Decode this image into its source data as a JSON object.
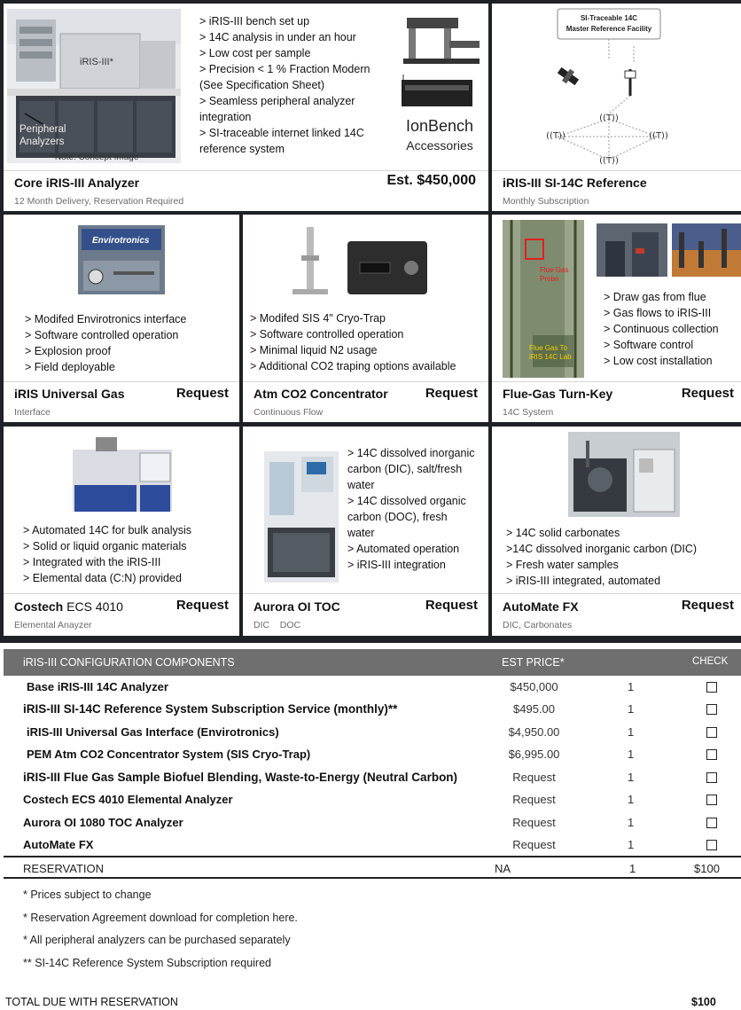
{
  "cards": {
    "core": {
      "bullets": [
        "> iRIS-III bench set up",
        "> 14C analysis in under an hour",
        "> Low cost per sample",
        "> Precision < 1 % Fraction Modern",
        "(See Specification Sheet)",
        "> Seamless peripheral analyzer",
        "integration",
        "> SI-traceable internet linked 14C",
        "reference system"
      ],
      "image_labels": {
        "device": "iRIS-III*",
        "peripheral": "Peripheral",
        "analyzers": "Analyzers",
        "note": "*Note: Concept Image"
      },
      "accessory_caption_1": "IonBench",
      "accessory_caption_2": "Accessories",
      "title": "Core iRIS-III Analyzer",
      "price": "Est. $450,000",
      "subtitle": "12 Month Delivery, Reservation Required"
    },
    "reference": {
      "diagram_title_1": "SI-Traceable 14C",
      "diagram_title_2": "Master Reference Facility",
      "title": "iRIS-III SI-14C Reference",
      "subtitle": "Monthly Subscription"
    },
    "gas": {
      "image_label": "Envirotronics",
      "bullets": [
        "> Modifed Envirotronics interface",
        "> Software controlled operation",
        "> Explosion proof",
        "> Field deployable"
      ],
      "title": "iRIS Universal Gas",
      "price": "Request",
      "subtitle": "Interface"
    },
    "co2": {
      "bullets": [
        "> Modifed SIS 4\" Cryo-Trap",
        "> Software controlled operation",
        "> Minimal liquid N2 usage",
        "> Additional CO2 traping options available"
      ],
      "title": "Atm CO2 Concentrator",
      "price": "Request",
      "subtitle": "Continuous Flow"
    },
    "flue": {
      "image_labels": {
        "probe": "Flue Gas Probe",
        "to_lab": "Flue Gas To iRIS 14C Lab"
      },
      "bullets": [
        "> Draw gas from flue",
        "> Gas flows to iRIS-III",
        "> Continuous collection",
        "> Software control",
        "> Low cost installation"
      ],
      "title": "Flue-Gas Turn-Key",
      "price": "Request",
      "subtitle": "14C System"
    },
    "costech": {
      "bullets": [
        "> Automated 14C for bulk analysis",
        "> Solid or liquid organic materials",
        "> Integrated with the iRIS-III",
        "> Elemental data (C:N) provided"
      ],
      "title_bold": "Costech",
      "title_rest": " ECS 4010",
      "price": "Request",
      "subtitle": "Elemental Anayzer"
    },
    "aurora": {
      "bullets": [
        "> 14C dissolved inorganic",
        "carbon (DIC), salt/fresh",
        "water",
        "> 14C dissolved organic",
        "carbon (DOC), fresh",
        "water",
        "> Automated operation",
        "> iRIS-III integration"
      ],
      "title": "Aurora OI TOC",
      "price": "Request",
      "subtitle": "DIC    DOC"
    },
    "automate": {
      "bullets": [
        "> 14C solid carbonates",
        ">14C dissolved inorganic carbon (DIC)",
        "> Fresh water samples",
        "> iRIS-III integrated, automated"
      ],
      "title": "AutoMate FX",
      "price": "Request",
      "subtitle": "DIC, Carbonates"
    }
  },
  "config": {
    "headers": {
      "component": "iRIS-III CONFIGURATION COMPONENTS",
      "price": "EST PRICE*",
      "check": "CHECK"
    },
    "rows": [
      {
        "name": "Base iRIS-III 14C Analyzer",
        "price": "$450,000",
        "qty": "1"
      },
      {
        "name": "iRIS-III SI-14C Reference System Subscription Service (monthly)**",
        "price": "$495.00",
        "qty": "1"
      },
      {
        "name": "iRIS-III Universal Gas Interface (Envirotronics)",
        "price": "$4,950.00",
        "qty": "1"
      },
      {
        "name": "PEM Atm CO2 Concentrator System (SIS Cryo-Trap)",
        "price": "$6,995.00",
        "qty": "1"
      },
      {
        "name": "iRIS-III Flue Gas Sample Biofuel Blending, Waste-to-Energy (Neutral Carbon)",
        "price": "Request",
        "qty": "1"
      },
      {
        "name": "Costech ECS 4010 Elemental Analyzer",
        "price": "Request",
        "qty": "1"
      },
      {
        "name": "Aurora OI 1080 TOC Analyzer",
        "price": "Request",
        "qty": "1"
      },
      {
        "name": "AutoMate FX",
        "price": "Request",
        "qty": "1"
      }
    ],
    "reservation": {
      "label": "RESERVATION",
      "price": "NA",
      "qty": "1",
      "amount": "$100"
    },
    "notes": [
      "* Prices subject to change",
      "* Reservation Agreement download for completion here.",
      "* All peripheral analyzers can be purchased separately",
      "** SI-14C Reference System Subscription required"
    ],
    "total": {
      "label": "TOTAL DUE WITH RESERVATION",
      "amount": "$100"
    }
  }
}
